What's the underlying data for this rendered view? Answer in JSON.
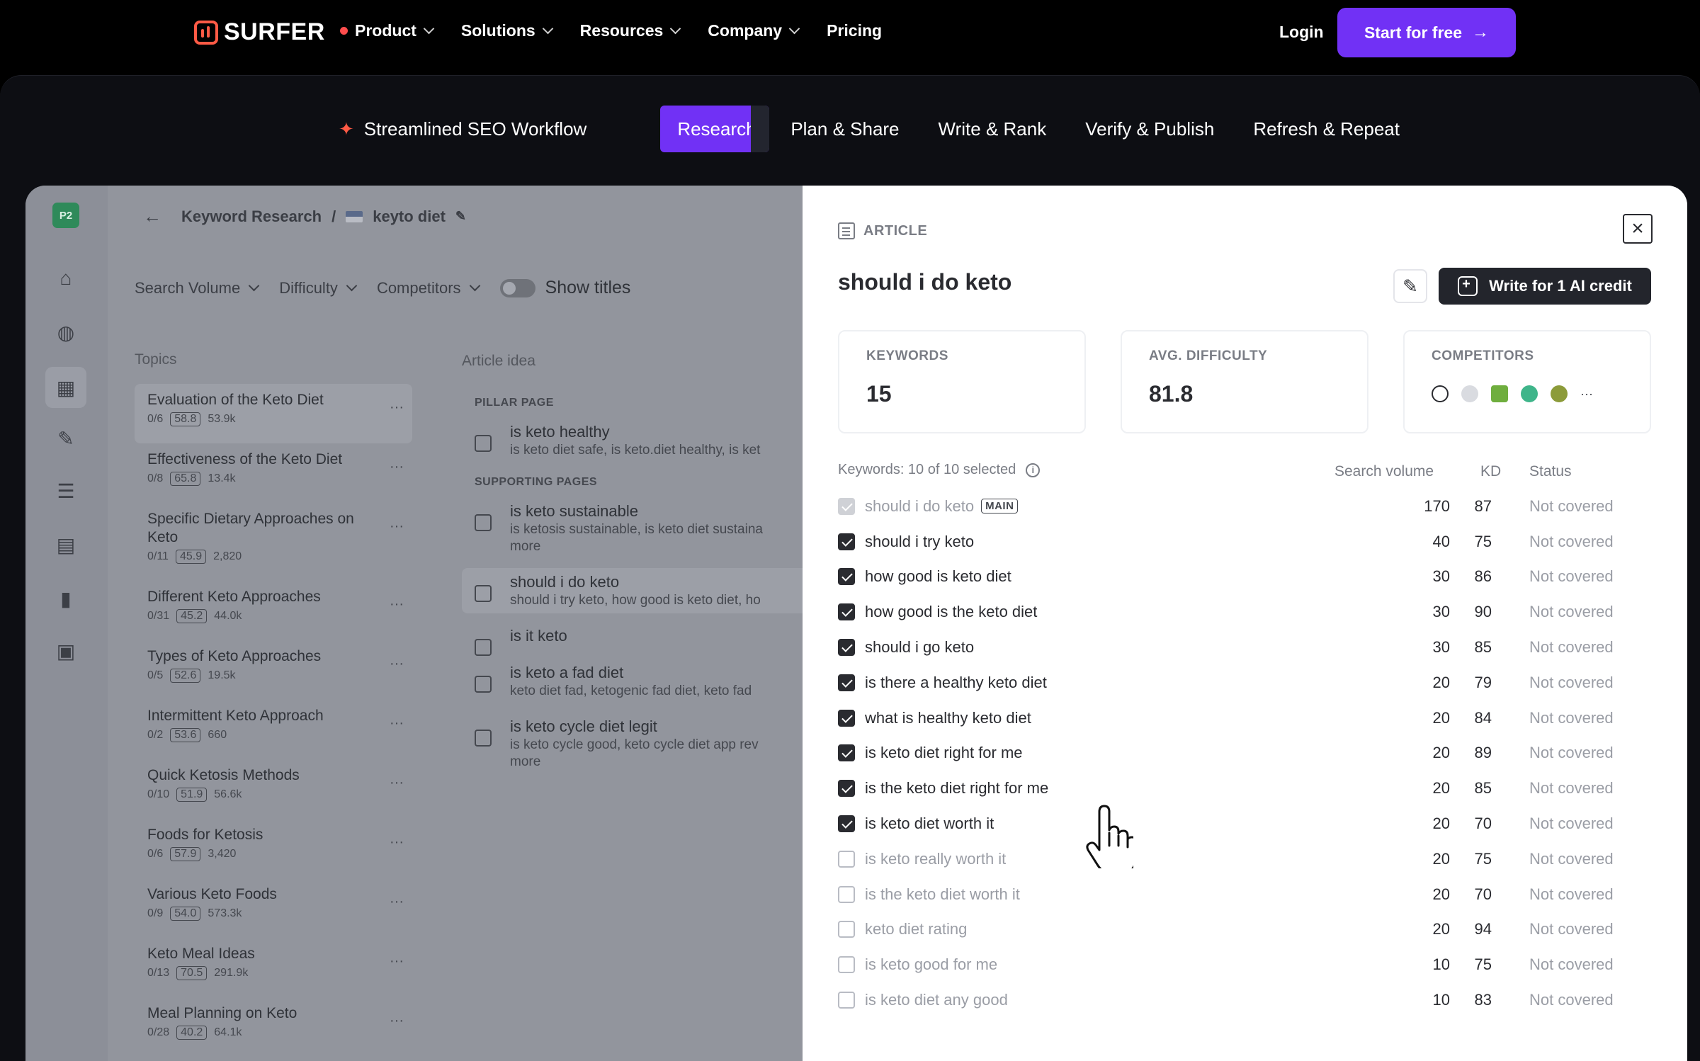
{
  "nav": {
    "logo_text": "SURFER",
    "menu": [
      {
        "label": "Product",
        "dot": true,
        "chevron": true
      },
      {
        "label": "Solutions",
        "dot": false,
        "chevron": true
      },
      {
        "label": "Resources",
        "dot": false,
        "chevron": true
      },
      {
        "label": "Company",
        "dot": false,
        "chevron": true
      },
      {
        "label": "Pricing",
        "dot": false,
        "chevron": false
      }
    ],
    "login": "Login",
    "cta": "Start for free"
  },
  "workflow": {
    "label": "Streamlined SEO Workflow",
    "tabs": [
      "Research",
      "Plan & Share",
      "Write & Rank",
      "Verify & Publish",
      "Refresh & Repeat"
    ],
    "active": "Research"
  },
  "app": {
    "badge": "P2",
    "breadcrumb": {
      "section": "Keyword Research",
      "sep": "/",
      "keyword": "keyto diet"
    },
    "filters": [
      "Search Volume",
      "Difficulty",
      "Competitors"
    ],
    "show_titles": "Show titles",
    "topics_head": "Topics",
    "topics": [
      {
        "name": "Evaluation of the Keto Diet",
        "progress": "0/6",
        "kd": "58.8",
        "volume": "53.9k"
      },
      {
        "name": "Effectiveness of the Keto Diet",
        "progress": "0/8",
        "kd": "65.8",
        "volume": "13.4k"
      },
      {
        "name": "Specific Dietary Approaches on Keto",
        "progress": "0/11",
        "kd": "45.9",
        "volume": "2,820"
      },
      {
        "name": "Different Keto Approaches",
        "progress": "0/31",
        "kd": "45.2",
        "volume": "44.0k"
      },
      {
        "name": "Types of Keto Approaches",
        "progress": "0/5",
        "kd": "52.6",
        "volume": "19.5k"
      },
      {
        "name": "Intermittent Keto Approach",
        "progress": "0/2",
        "kd": "53.6",
        "volume": "660"
      },
      {
        "name": "Quick Ketosis Methods",
        "progress": "0/10",
        "kd": "51.9",
        "volume": "56.6k"
      },
      {
        "name": "Foods for Ketosis",
        "progress": "0/6",
        "kd": "57.9",
        "volume": "3,420"
      },
      {
        "name": "Various Keto Foods",
        "progress": "0/9",
        "kd": "54.0",
        "volume": "573.3k"
      },
      {
        "name": "Keto Meal Ideas",
        "progress": "0/13",
        "kd": "70.5",
        "volume": "291.9k"
      },
      {
        "name": "Meal Planning on Keto",
        "progress": "0/28",
        "kd": "40.2",
        "volume": "64.1k"
      }
    ],
    "articles_head": "Article idea",
    "pillar_head": "PILLAR PAGE",
    "supporting_head": "SUPPORTING PAGES",
    "pillar": {
      "title": "is keto healthy",
      "sub": "is keto diet safe, is keto.diet healthy, is ket"
    },
    "supporting": [
      {
        "title": "is keto sustainable",
        "sub": "is ketosis sustainable, is keto diet sustaina",
        "more": "more"
      },
      {
        "title": "should i do keto",
        "sub": "should i try keto, how good is keto diet, ho",
        "more": ""
      },
      {
        "title": "is it keto",
        "sub": "",
        "more": ""
      },
      {
        "title": "is keto a fad diet",
        "sub": "keto diet fad, ketogenic fad diet, keto fad",
        "more": ""
      },
      {
        "title": "is keto cycle diet legit",
        "sub": "is keto cycle good, keto cycle diet app rev",
        "more": "more"
      }
    ]
  },
  "panel": {
    "type_label": "ARTICLE",
    "title": "should i do keto",
    "write_button": "Write for 1 AI credit",
    "stats": [
      {
        "label": "KEYWORDS",
        "value": "15"
      },
      {
        "label": "AVG. DIFFICULTY",
        "value": "81.8"
      },
      {
        "label": "COMPETITORS",
        "value": ""
      }
    ],
    "competitor_icons": [
      "competitor-d-icon",
      "competitor-person-icon",
      "competitor-green-icon",
      "competitor-apple-icon",
      "competitor-leaf-icon"
    ],
    "competitor_more": "···",
    "selected_summary": "Keywords: 10 of 10 selected",
    "columns": {
      "volume": "Search volume",
      "kd": "KD",
      "status": "Status"
    },
    "main_tag": "MAIN",
    "keywords": [
      {
        "keyword": "should i do keto",
        "volume": "170",
        "kd": "87",
        "status": "Not covered",
        "checked": true,
        "main": true
      },
      {
        "keyword": "should i try keto",
        "volume": "40",
        "kd": "75",
        "status": "Not covered",
        "checked": true,
        "main": false
      },
      {
        "keyword": "how good is keto diet",
        "volume": "30",
        "kd": "86",
        "status": "Not covered",
        "checked": true,
        "main": false
      },
      {
        "keyword": "how good is the keto diet",
        "volume": "30",
        "kd": "90",
        "status": "Not covered",
        "checked": true,
        "main": false
      },
      {
        "keyword": "should i go keto",
        "volume": "30",
        "kd": "85",
        "status": "Not covered",
        "checked": true,
        "main": false
      },
      {
        "keyword": "is there a healthy keto diet",
        "volume": "20",
        "kd": "79",
        "status": "Not covered",
        "checked": true,
        "main": false
      },
      {
        "keyword": "what is healthy keto diet",
        "volume": "20",
        "kd": "84",
        "status": "Not covered",
        "checked": true,
        "main": false
      },
      {
        "keyword": "is keto diet right for me",
        "volume": "20",
        "kd": "89",
        "status": "Not covered",
        "checked": true,
        "main": false
      },
      {
        "keyword": "is the keto diet right for me",
        "volume": "20",
        "kd": "85",
        "status": "Not covered",
        "checked": true,
        "main": false
      },
      {
        "keyword": "is keto diet worth it",
        "volume": "20",
        "kd": "70",
        "status": "Not covered",
        "checked": true,
        "main": false
      },
      {
        "keyword": "is keto really worth it",
        "volume": "20",
        "kd": "75",
        "status": "Not covered",
        "checked": false,
        "main": false
      },
      {
        "keyword": "is the keto diet worth it",
        "volume": "20",
        "kd": "70",
        "status": "Not covered",
        "checked": false,
        "main": false
      },
      {
        "keyword": "keto diet rating",
        "volume": "20",
        "kd": "94",
        "status": "Not covered",
        "checked": false,
        "main": false
      },
      {
        "keyword": "is keto good for me",
        "volume": "10",
        "kd": "75",
        "status": "Not covered",
        "checked": false,
        "main": false
      },
      {
        "keyword": "is keto diet any good",
        "volume": "10",
        "kd": "83",
        "status": "Not covered",
        "checked": false,
        "main": false
      }
    ]
  },
  "colors": {
    "brand": "#7131f5",
    "logo": "#ff5a45",
    "dark_button": "#23252c"
  }
}
